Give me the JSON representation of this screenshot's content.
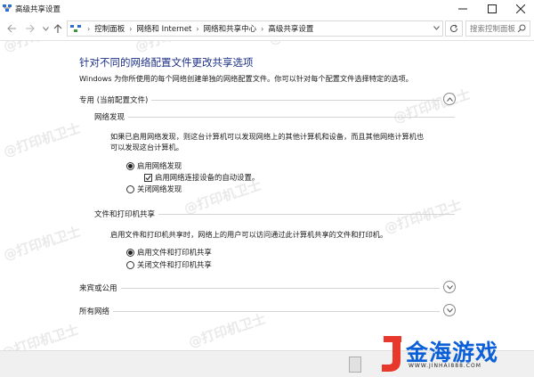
{
  "window": {
    "title": "高级共享设置"
  },
  "nav": {
    "breadcrumb": [
      "控制面板",
      "网络和 Internet",
      "网络和共享中心",
      "高级共享设置"
    ],
    "search_placeholder": "搜索控制面板"
  },
  "main": {
    "heading": "针对不同的网络配置文件更改共享选项",
    "description": "Windows 为你所使用的每个网络创建单独的网络配置文件。你可以针对每个配置文件选择特定的选项。"
  },
  "private_section": {
    "label": "专用 (当前配置文件)",
    "discovery": {
      "label": "网络发现",
      "text_line1": "如果已启用网络发现，则这台计算机可以发现网络上的其他计算机和设备，而且其他网络计算机也",
      "text_line2": "可以发现这台计算机。",
      "on_label": "启用网络发现",
      "auto_label": "启用网络连接设备的自动设置。",
      "off_label": "关闭网络发现"
    },
    "sharing": {
      "label": "文件和打印机共享",
      "text": "启用文件和打印机共享时，网络上的用户可以访问通过此计算机共享的文件和打印机。",
      "on_label": "启用文件和打印机共享",
      "off_label": "关闭文件和打印机共享"
    }
  },
  "guest_section": {
    "label": "来宾或公用"
  },
  "all_section": {
    "label": "所有网络"
  },
  "watermark_text": "@打印机卫士",
  "brand": {
    "name": "金海游戏",
    "url": "WWW.JINHAI888.COM"
  },
  "colors": {
    "heading": "#1e3287",
    "brand_blue": "#0b5fd8",
    "brand_red": "#e8382b"
  },
  "state": {
    "discovery_on": true,
    "auto_setup_checked": true,
    "sharing_on": true
  }
}
